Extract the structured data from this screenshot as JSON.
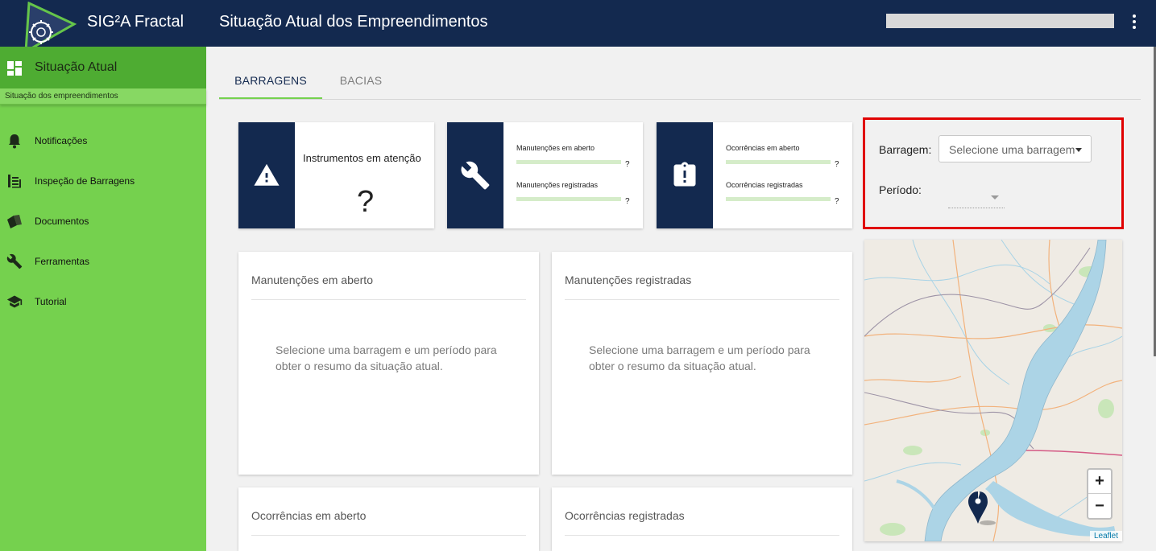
{
  "header": {
    "app_title": "SIG²A Fractal",
    "page_title": "Situação Atual dos Empreendimentos",
    "menu_icon": "more-vert-icon"
  },
  "sidebar": {
    "active": {
      "label": "Situação Atual",
      "sublabel": "Situação dos empreendimentos",
      "icon": "dashboard-icon"
    },
    "items": [
      {
        "label": "Notificações",
        "icon": "bell-icon"
      },
      {
        "label": "Inspeção de Barragens",
        "icon": "inspection-icon"
      },
      {
        "label": "Documentos",
        "icon": "documents-icon"
      },
      {
        "label": "Ferramentas",
        "icon": "wrench-icon"
      },
      {
        "label": "Tutorial",
        "icon": "graduation-cap-icon"
      }
    ]
  },
  "tabs": [
    {
      "label": "BARRAGENS",
      "active": true
    },
    {
      "label": "BACIAS",
      "active": false
    }
  ],
  "stats": {
    "instrumentos": {
      "title": "Instrumentos em atenção",
      "value": "?",
      "icon": "warning-icon"
    },
    "manutencoes": {
      "icon": "wrench-icon",
      "rows": [
        {
          "label": "Manutenções em aberto",
          "value": "?"
        },
        {
          "label": "Manutenções registradas",
          "value": "?"
        }
      ]
    },
    "ocorrencias": {
      "icon": "clipboard-alert-icon",
      "rows": [
        {
          "label": "Ocorrências em aberto",
          "value": "?"
        },
        {
          "label": "Ocorrências registradas",
          "value": "?"
        }
      ]
    }
  },
  "filters": {
    "barragem_label": "Barragem:",
    "barragem_value": "Selecione uma barragem",
    "periodo_label": "Período:"
  },
  "panels": [
    {
      "title": "Manutenções em aberto",
      "message": "Selecione uma barragem e um período para obter o resumo da situação atual."
    },
    {
      "title": "Manutenções registradas",
      "message": "Selecione uma barragem e um período para obter o resumo da situação atual."
    },
    {
      "title": "Ocorrências em aberto"
    },
    {
      "title": "Ocorrências registradas"
    }
  ],
  "map": {
    "zoom_in": "+",
    "zoom_out": "−",
    "attribution": "Leaflet"
  },
  "colors": {
    "navy": "#13294f",
    "green": "#75d14e",
    "green_dark": "#4eac32",
    "highlight": "#e00000"
  }
}
